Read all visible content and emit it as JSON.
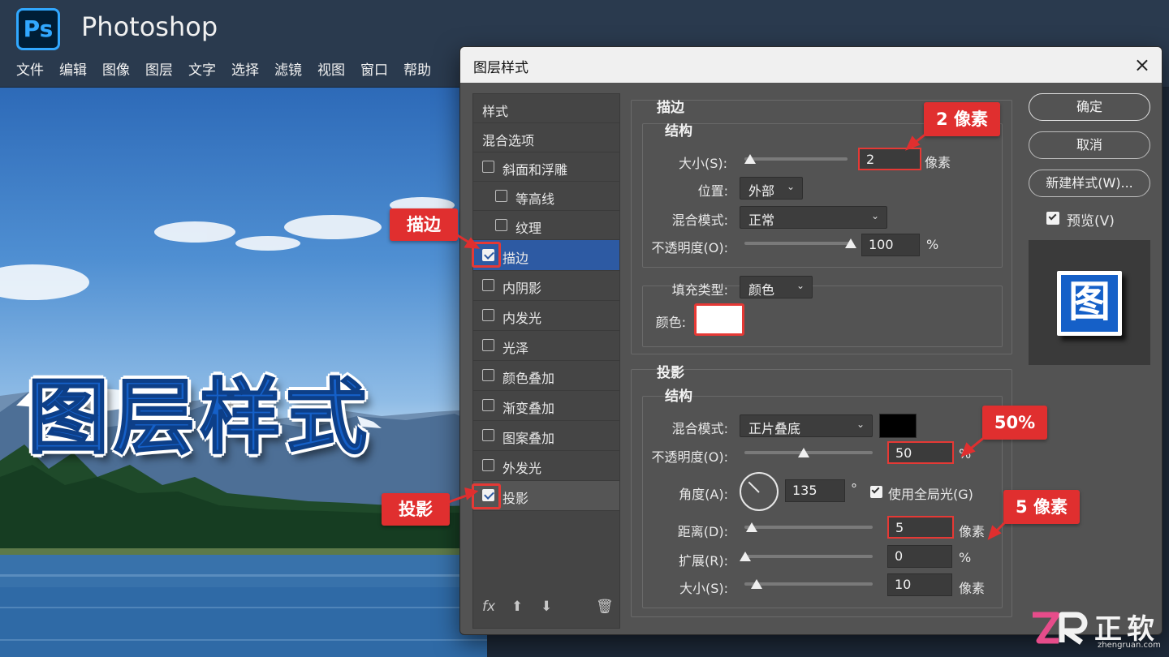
{
  "app": {
    "logo": "Ps",
    "title": "Photoshop"
  },
  "menu": [
    "文件",
    "编辑",
    "图像",
    "图层",
    "文字",
    "选择",
    "滤镜",
    "视图",
    "窗口",
    "帮助"
  ],
  "canvas": {
    "title": "图层样式"
  },
  "dialog": {
    "title": "图层样式",
    "close_icon": "×",
    "style_list": {
      "header": "样式",
      "blend_options": "混合选项",
      "items": [
        {
          "label": "斜面和浮雕",
          "checked": false
        },
        {
          "label": "等高线",
          "checked": false
        },
        {
          "label": "纹理",
          "checked": false
        },
        {
          "label": "描边",
          "checked": true
        },
        {
          "label": "内阴影",
          "checked": false
        },
        {
          "label": "内发光",
          "checked": false
        },
        {
          "label": "光泽",
          "checked": false
        },
        {
          "label": "颜色叠加",
          "checked": false
        },
        {
          "label": "渐变叠加",
          "checked": false
        },
        {
          "label": "图案叠加",
          "checked": false
        },
        {
          "label": "外发光",
          "checked": false
        },
        {
          "label": "投影",
          "checked": true
        }
      ],
      "footer": {
        "fx": "fx",
        "up": "⬆",
        "down": "⬇",
        "delete": "🗑"
      }
    },
    "stroke": {
      "title": "描边",
      "structure": "结构",
      "size_label": "大小(S):",
      "size_value": "2",
      "size_unit": "像素",
      "position_label": "位置:",
      "position_value": "外部",
      "blend_label": "混合模式:",
      "blend_value": "正常",
      "opacity_label": "不透明度(O):",
      "opacity_value": "100",
      "opacity_unit": "%",
      "fill_type_label": "填充类型:",
      "fill_type_value": "颜色",
      "color_label": "颜色:",
      "color_value": "#ffffff"
    },
    "drop_shadow": {
      "title": "投影",
      "structure": "结构",
      "blend_label": "混合模式:",
      "blend_value": "正片叠底",
      "blend_color": "#000000",
      "opacity_label": "不透明度(O):",
      "opacity_value": "50",
      "opacity_unit": "%",
      "angle_label": "角度(A):",
      "angle_value": "135",
      "angle_unit": "°",
      "global_light_label": "使用全局光(G)",
      "distance_label": "距离(D):",
      "distance_value": "5",
      "distance_unit": "像素",
      "spread_label": "扩展(R):",
      "spread_value": "0",
      "spread_unit": "%",
      "size_label": "大小(S):",
      "size_value": "10",
      "size_unit": "像素"
    },
    "buttons": {
      "ok": "确定",
      "cancel": "取消",
      "new_style": "新建样式(W)...",
      "preview": "预览(V)"
    },
    "preview_glyph": "图"
  },
  "annotations": {
    "stroke_tag": "描边",
    "shadow_tag": "投影",
    "stroke_size": "2 像素",
    "shadow_opacity": "50%",
    "shadow_distance": "5 像素"
  },
  "watermark": {
    "logo": "ZR",
    "name": "正软",
    "url": "zhengruan.com"
  },
  "colors": {
    "accent": "#2d5aa3",
    "callout": "#e02f2f",
    "ps_blue": "#31a8ff"
  }
}
